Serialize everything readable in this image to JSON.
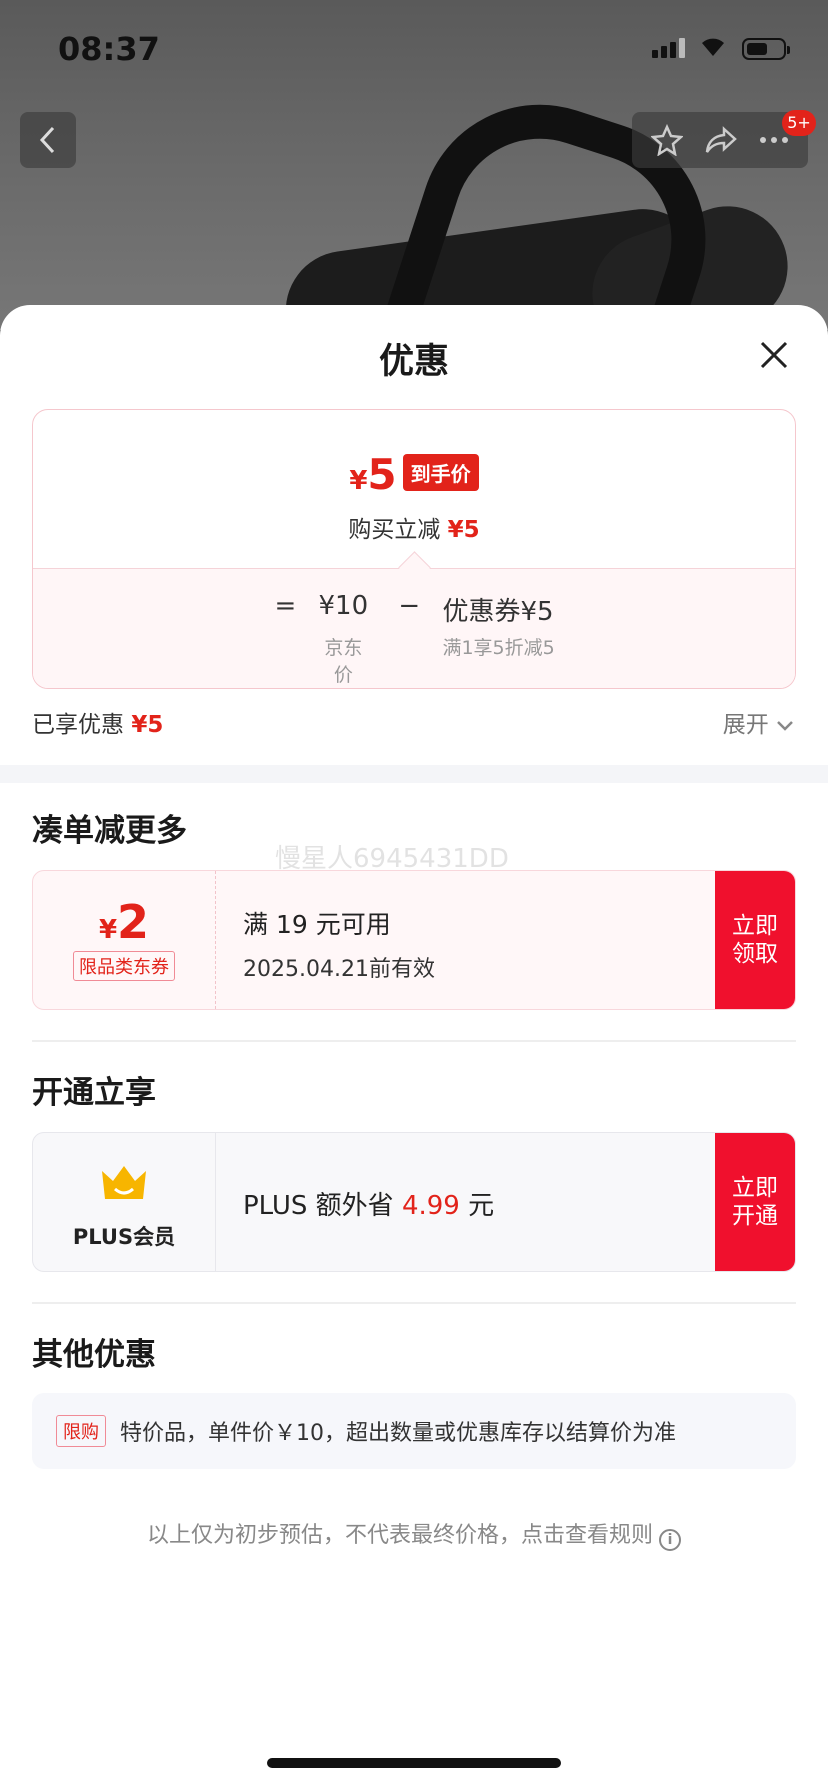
{
  "status_bar": {
    "time": "08:37"
  },
  "nav": {
    "badge": "5+"
  },
  "sheet": {
    "title": "优惠",
    "price_card": {
      "final_price_symbol": "¥",
      "final_price": "5",
      "final_price_tag": "到手价",
      "reduce_label": "购买立减",
      "reduce_amount": "¥5",
      "equals": "=",
      "jd_price": "¥10",
      "jd_price_label": "京东价",
      "minus": "−",
      "coupon_label": "优惠券¥5",
      "coupon_desc": "满1享5折减5"
    },
    "enjoyed": {
      "label": "已享优惠",
      "amount": "¥5",
      "expand_label": "展开"
    },
    "sections": {
      "more": {
        "title": "凑单减更多",
        "watermark": "慢星人6945431DD",
        "coupon": {
          "symbol": "¥",
          "amount": "2",
          "tag": "限品类东券",
          "condition": "满 19 元可用",
          "validity": "2025.04.21前有效",
          "action_line1": "立即",
          "action_line2": "领取"
        }
      },
      "plus": {
        "title": "开通立享",
        "label": "PLUS会员",
        "text_prefix": "PLUS 额外省 ",
        "amount": "4.99",
        "text_suffix": " 元",
        "action_line1": "立即",
        "action_line2": "开通"
      },
      "other": {
        "title": "其他优惠",
        "tag": "限购",
        "text": "特价品，单件价￥10，超出数量或优惠库存以结算价为准"
      }
    },
    "footnote": "以上仅为初步预估，不代表最终价格，点击查看规则",
    "info_icon_glyph": "i"
  },
  "colors": {
    "accent_red": "#e2231a",
    "button_red": "#f0102d",
    "crown_gold": "#f7b500"
  }
}
